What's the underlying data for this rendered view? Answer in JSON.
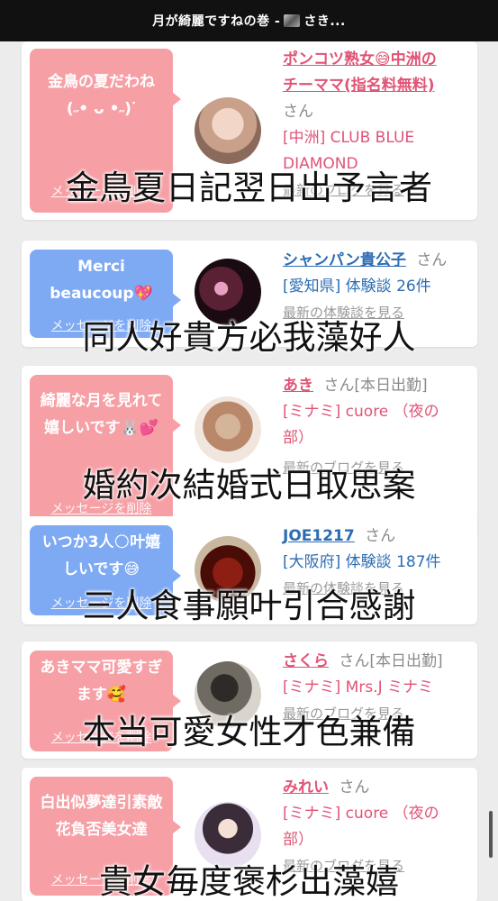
{
  "header": {
    "title": "月が綺麗ですねの巻 - ",
    "title_suffix": "さき..."
  },
  "cards": [
    {
      "message": "金鳥の夏だわね (ˉ̞̭ ⌓ ˉ̞̭)⁾⁾",
      "message_lines": [
        "金鳥の夏だわね",
        "(˶• ᴗ •˶)ᐝ"
      ],
      "delete": "メッセージを削除",
      "color": "pink",
      "name_lines": [
        "ポンコツ熟女😅中洲の",
        "チーママ(指名料無料)"
      ],
      "san": "さん",
      "details": [
        "[中洲] CLUB BLUE",
        "DIAMOND"
      ],
      "blog": "最新のブログを見る",
      "caption": "金鳥夏日記翌日出予言者"
    },
    {
      "message_lines": [
        "Merci",
        "beaucoup💖"
      ],
      "delete": "メッセージを削除",
      "color": "blue",
      "name_lines": [
        "シャンパン貴公子"
      ],
      "san": "さん",
      "details": [
        "[愛知県] 体験談 26件"
      ],
      "blog": "最新の体験談を見る",
      "caption": "同人好貴方必我藻好人"
    },
    {
      "message_lines": [
        "綺麗な月を見れて",
        "嬉しいです🐰💕"
      ],
      "delete": "メッセージを削除",
      "color": "pink",
      "name_lines": [
        "あき"
      ],
      "san": "さん[本日出勤]",
      "details": [
        "[ミナミ] cuore （夜の",
        "部）"
      ],
      "blog": "最新のブログを見る",
      "caption": "婚約次結婚式日取思案"
    },
    {
      "message_lines": [
        "いつか3人🌕叶嬉",
        "しいです😅"
      ],
      "delete": "メッセージを削除",
      "color": "blue",
      "name_lines": [
        "JOE1217"
      ],
      "san": "さん",
      "details": [
        "[大阪府] 体験談 187件"
      ],
      "blog": "最新の体験談を見る",
      "caption": "三人食事願叶引合感謝"
    },
    {
      "message_lines": [
        "あきママ可愛すぎ",
        "ます🥰"
      ],
      "delete": "メッセージを削除",
      "color": "pink",
      "name_lines": [
        "さくら"
      ],
      "san": "さん[本日出勤]",
      "details": [
        "[ミナミ] Mrs.J ミナミ"
      ],
      "blog": "最新のブログを見る",
      "caption": "本当可愛女性才色兼備"
    },
    {
      "message_lines": [
        "白出似夢達引素敵",
        "花負否美女達"
      ],
      "delete": "メッセージを削除",
      "color": "pink",
      "name_lines": [
        "みれい"
      ],
      "san": "さん",
      "details": [
        "[ミナミ] cuore （夜の",
        "部）"
      ],
      "blog": "最新のブログを見る",
      "caption": "貴女毎度褒杉出藻嬉"
    }
  ],
  "colors": {
    "pink_bubble": "#f6a0a6",
    "blue_bubble": "#7ea9f3",
    "name_pink": "#e05476",
    "name_blue": "#2c6db3"
  }
}
